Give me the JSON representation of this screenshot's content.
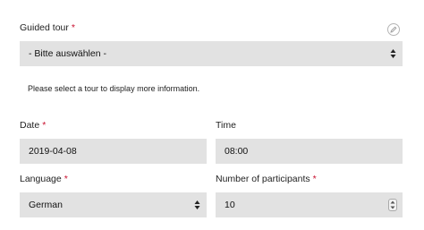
{
  "tour": {
    "label": "Guided tour",
    "required_mark": "*",
    "selected": "- Bitte auswählen -",
    "info": "Please select a tour to display more information.",
    "edit_icon": "pencil-icon"
  },
  "date": {
    "label": "Date",
    "required_mark": "*",
    "value": "2019-04-08"
  },
  "time": {
    "label": "Time",
    "value": "08:00"
  },
  "language": {
    "label": "Language",
    "required_mark": "*",
    "selected": "German"
  },
  "participants": {
    "label": "Number of participants",
    "required_mark": "*",
    "value": "10"
  },
  "colors": {
    "field_bg": "#e2e2e2",
    "required": "#c8102e"
  }
}
